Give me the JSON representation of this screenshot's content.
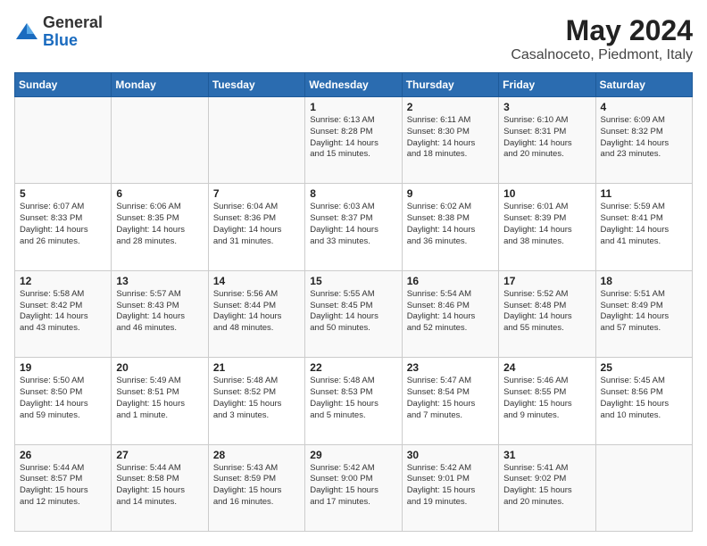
{
  "header": {
    "logo_general": "General",
    "logo_blue": "Blue",
    "month_year": "May 2024",
    "location": "Casalnoceto, Piedmont, Italy"
  },
  "days_of_week": [
    "Sunday",
    "Monday",
    "Tuesday",
    "Wednesday",
    "Thursday",
    "Friday",
    "Saturday"
  ],
  "weeks": [
    [
      {
        "day": "",
        "info": ""
      },
      {
        "day": "",
        "info": ""
      },
      {
        "day": "",
        "info": ""
      },
      {
        "day": "1",
        "info": "Sunrise: 6:13 AM\nSunset: 8:28 PM\nDaylight: 14 hours\nand 15 minutes."
      },
      {
        "day": "2",
        "info": "Sunrise: 6:11 AM\nSunset: 8:30 PM\nDaylight: 14 hours\nand 18 minutes."
      },
      {
        "day": "3",
        "info": "Sunrise: 6:10 AM\nSunset: 8:31 PM\nDaylight: 14 hours\nand 20 minutes."
      },
      {
        "day": "4",
        "info": "Sunrise: 6:09 AM\nSunset: 8:32 PM\nDaylight: 14 hours\nand 23 minutes."
      }
    ],
    [
      {
        "day": "5",
        "info": "Sunrise: 6:07 AM\nSunset: 8:33 PM\nDaylight: 14 hours\nand 26 minutes."
      },
      {
        "day": "6",
        "info": "Sunrise: 6:06 AM\nSunset: 8:35 PM\nDaylight: 14 hours\nand 28 minutes."
      },
      {
        "day": "7",
        "info": "Sunrise: 6:04 AM\nSunset: 8:36 PM\nDaylight: 14 hours\nand 31 minutes."
      },
      {
        "day": "8",
        "info": "Sunrise: 6:03 AM\nSunset: 8:37 PM\nDaylight: 14 hours\nand 33 minutes."
      },
      {
        "day": "9",
        "info": "Sunrise: 6:02 AM\nSunset: 8:38 PM\nDaylight: 14 hours\nand 36 minutes."
      },
      {
        "day": "10",
        "info": "Sunrise: 6:01 AM\nSunset: 8:39 PM\nDaylight: 14 hours\nand 38 minutes."
      },
      {
        "day": "11",
        "info": "Sunrise: 5:59 AM\nSunset: 8:41 PM\nDaylight: 14 hours\nand 41 minutes."
      }
    ],
    [
      {
        "day": "12",
        "info": "Sunrise: 5:58 AM\nSunset: 8:42 PM\nDaylight: 14 hours\nand 43 minutes."
      },
      {
        "day": "13",
        "info": "Sunrise: 5:57 AM\nSunset: 8:43 PM\nDaylight: 14 hours\nand 46 minutes."
      },
      {
        "day": "14",
        "info": "Sunrise: 5:56 AM\nSunset: 8:44 PM\nDaylight: 14 hours\nand 48 minutes."
      },
      {
        "day": "15",
        "info": "Sunrise: 5:55 AM\nSunset: 8:45 PM\nDaylight: 14 hours\nand 50 minutes."
      },
      {
        "day": "16",
        "info": "Sunrise: 5:54 AM\nSunset: 8:46 PM\nDaylight: 14 hours\nand 52 minutes."
      },
      {
        "day": "17",
        "info": "Sunrise: 5:52 AM\nSunset: 8:48 PM\nDaylight: 14 hours\nand 55 minutes."
      },
      {
        "day": "18",
        "info": "Sunrise: 5:51 AM\nSunset: 8:49 PM\nDaylight: 14 hours\nand 57 minutes."
      }
    ],
    [
      {
        "day": "19",
        "info": "Sunrise: 5:50 AM\nSunset: 8:50 PM\nDaylight: 14 hours\nand 59 minutes."
      },
      {
        "day": "20",
        "info": "Sunrise: 5:49 AM\nSunset: 8:51 PM\nDaylight: 15 hours\nand 1 minute."
      },
      {
        "day": "21",
        "info": "Sunrise: 5:48 AM\nSunset: 8:52 PM\nDaylight: 15 hours\nand 3 minutes."
      },
      {
        "day": "22",
        "info": "Sunrise: 5:48 AM\nSunset: 8:53 PM\nDaylight: 15 hours\nand 5 minutes."
      },
      {
        "day": "23",
        "info": "Sunrise: 5:47 AM\nSunset: 8:54 PM\nDaylight: 15 hours\nand 7 minutes."
      },
      {
        "day": "24",
        "info": "Sunrise: 5:46 AM\nSunset: 8:55 PM\nDaylight: 15 hours\nand 9 minutes."
      },
      {
        "day": "25",
        "info": "Sunrise: 5:45 AM\nSunset: 8:56 PM\nDaylight: 15 hours\nand 10 minutes."
      }
    ],
    [
      {
        "day": "26",
        "info": "Sunrise: 5:44 AM\nSunset: 8:57 PM\nDaylight: 15 hours\nand 12 minutes."
      },
      {
        "day": "27",
        "info": "Sunrise: 5:44 AM\nSunset: 8:58 PM\nDaylight: 15 hours\nand 14 minutes."
      },
      {
        "day": "28",
        "info": "Sunrise: 5:43 AM\nSunset: 8:59 PM\nDaylight: 15 hours\nand 16 minutes."
      },
      {
        "day": "29",
        "info": "Sunrise: 5:42 AM\nSunset: 9:00 PM\nDaylight: 15 hours\nand 17 minutes."
      },
      {
        "day": "30",
        "info": "Sunrise: 5:42 AM\nSunset: 9:01 PM\nDaylight: 15 hours\nand 19 minutes."
      },
      {
        "day": "31",
        "info": "Sunrise: 5:41 AM\nSunset: 9:02 PM\nDaylight: 15 hours\nand 20 minutes."
      },
      {
        "day": "",
        "info": ""
      }
    ]
  ]
}
